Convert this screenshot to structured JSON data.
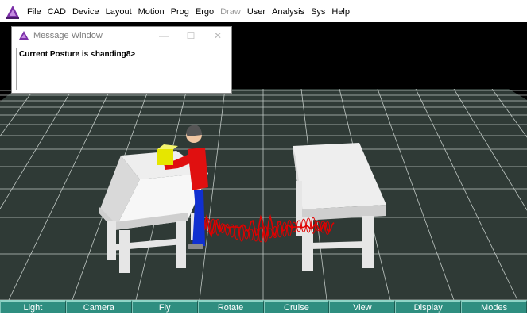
{
  "menubar": {
    "icon": "app-triangle-icon",
    "items": [
      {
        "label": "File",
        "enabled": true
      },
      {
        "label": "CAD",
        "enabled": true
      },
      {
        "label": "Device",
        "enabled": true
      },
      {
        "label": "Layout",
        "enabled": true
      },
      {
        "label": "Motion",
        "enabled": true
      },
      {
        "label": "Prog",
        "enabled": true
      },
      {
        "label": "Ergo",
        "enabled": true
      },
      {
        "label": "Draw",
        "enabled": false
      },
      {
        "label": "User",
        "enabled": true
      },
      {
        "label": "Analysis",
        "enabled": true
      },
      {
        "label": "Sys",
        "enabled": true
      },
      {
        "label": "Help",
        "enabled": true
      }
    ]
  },
  "message_window": {
    "title": "Message Window",
    "minimize": "—",
    "maximize": "☐",
    "close": "✕",
    "message": "Current Posture is <handing8>"
  },
  "scene": {
    "floor_color": "#2f3a36",
    "grid_color": "#bfc7c3",
    "table_color": "#eeeeee",
    "trajectory_color": "#e00000",
    "worker_shirt": "#e01010",
    "worker_pants": "#1030d0",
    "box_color": "#e6e600"
  },
  "toolbar": {
    "buttons": [
      "Light",
      "Camera",
      "Fly",
      "Rotate",
      "Cruise",
      "View",
      "Display",
      "Modes"
    ]
  }
}
